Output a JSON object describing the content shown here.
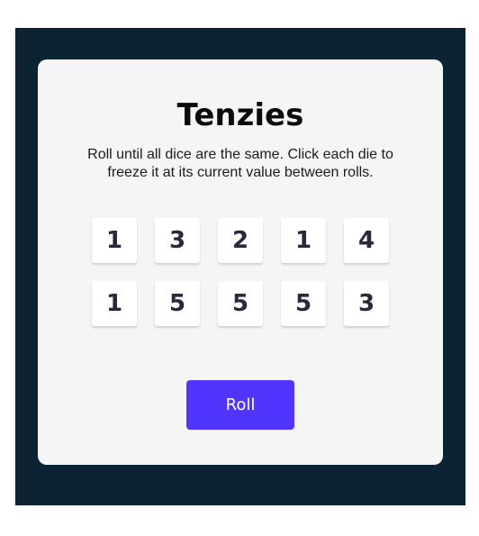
{
  "app": {
    "title": "Tenzies",
    "instructions": "Roll until all dice are the same. Click each die to freeze it at its current value between rolls."
  },
  "dice": [
    {
      "value": "1",
      "held": false
    },
    {
      "value": "3",
      "held": false
    },
    {
      "value": "2",
      "held": false
    },
    {
      "value": "1",
      "held": false
    },
    {
      "value": "4",
      "held": false
    },
    {
      "value": "1",
      "held": false
    },
    {
      "value": "5",
      "held": false
    },
    {
      "value": "5",
      "held": false
    },
    {
      "value": "5",
      "held": false
    },
    {
      "value": "3",
      "held": false
    }
  ],
  "controls": {
    "roll_label": "Roll"
  },
  "colors": {
    "background": "#0b2434",
    "card": "#f5f5f5",
    "button": "#5035ff",
    "die_text": "#2b283a"
  }
}
